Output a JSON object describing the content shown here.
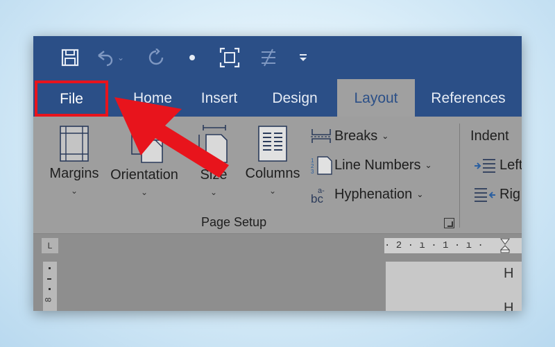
{
  "tabs": [
    {
      "label": "File",
      "active": false,
      "highlighted": true
    },
    {
      "label": "Home",
      "active": false
    },
    {
      "label": "Insert",
      "active": false
    },
    {
      "label": "Design",
      "active": false
    },
    {
      "label": "Layout",
      "active": true
    },
    {
      "label": "References",
      "active": false
    }
  ],
  "quick_access": [
    "save-icon",
    "undo-icon",
    "redo-icon",
    "dot-icon",
    "fit-icon",
    "touch-mode-icon",
    "customize-icon"
  ],
  "page_setup": {
    "group_label": "Page Setup",
    "buttons": [
      {
        "label": "Margins",
        "icon": "margins-icon"
      },
      {
        "label": "Orientation",
        "icon": "orientation-icon"
      },
      {
        "label": "Size",
        "icon": "size-icon"
      },
      {
        "label": "Columns",
        "icon": "columns-icon"
      }
    ],
    "small_buttons": [
      {
        "label": "Breaks",
        "icon": "breaks-icon"
      },
      {
        "label": "Line Numbers",
        "icon": "line-numbers-icon"
      },
      {
        "label": "Hyphenation",
        "icon": "hyphenation-icon"
      }
    ]
  },
  "paragraph": {
    "indent_label": "Indent",
    "left_label": "Left",
    "right_label": "Rig"
  },
  "ruler": {
    "corner_mark": "L",
    "h_marks": "· 2 · ı · 1 · ı ·",
    "v_marks": "8"
  },
  "page_text": [
    "H",
    "H"
  ],
  "colors": {
    "title_bar": "#2b4f87",
    "highlight": "#e8141c",
    "ribbon": "#9e9e9e"
  }
}
